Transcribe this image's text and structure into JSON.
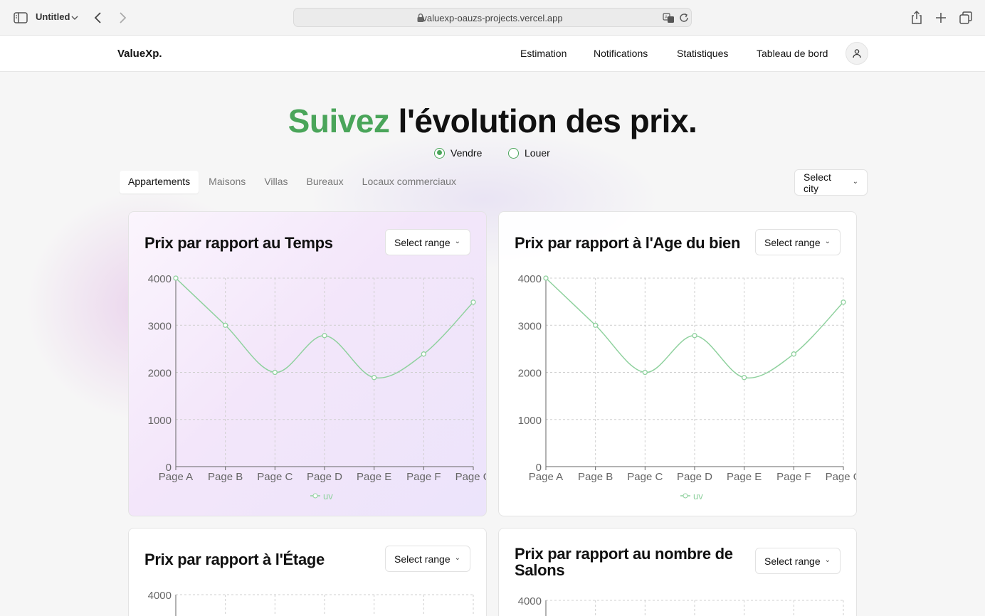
{
  "browser": {
    "tab_title": "Untitled",
    "url": "valuexp-oauzs-projects.vercel.app",
    "icons": [
      "sidebar-icon",
      "chevron-down-icon",
      "back-icon",
      "forward-icon",
      "lock-icon",
      "translate-icon",
      "reload-icon",
      "share-icon",
      "plus-icon",
      "tabs-icon"
    ]
  },
  "nav": {
    "brand": "ValueXp.",
    "links": [
      "Estimation",
      "Notifications",
      "Statistiques",
      "Tableau de bord"
    ],
    "avatar_icon": "user-icon"
  },
  "hero": {
    "accent_word": "Suivez",
    "rest": " l'évolution des prix.",
    "accent_color": "#4aa55a"
  },
  "mode": {
    "options": [
      "Vendre",
      "Louer"
    ],
    "selected": "Vendre"
  },
  "tabs": {
    "items": [
      "Appartements",
      "Maisons",
      "Villas",
      "Bureaux",
      "Locaux commerciaux"
    ],
    "active": "Appartements"
  },
  "city_select": {
    "label": "Select city"
  },
  "cards": [
    {
      "title": "Prix par rapport au Temps",
      "select_label": "Select range"
    },
    {
      "title": "Prix par rapport à l'Age du bien",
      "select_label": "Select range"
    },
    {
      "title": "Prix par rapport à l'Étage",
      "select_label": "Select range"
    },
    {
      "title": "Prix par rapport au nombre de Salons",
      "select_label": "Select range"
    }
  ],
  "chart_data": [
    {
      "type": "line",
      "categories": [
        "Page A",
        "Page B",
        "Page C",
        "Page D",
        "Page E",
        "Page F",
        "Page G"
      ],
      "series": [
        {
          "name": "uv",
          "values": [
            4000,
            3000,
            2000,
            2780,
            1890,
            2390,
            3490
          ]
        }
      ],
      "yticks": [
        0,
        1000,
        2000,
        3000,
        4000
      ],
      "ylim": [
        0,
        4000
      ],
      "grid": true,
      "legend": "bottom",
      "line_color": "#8fd19e"
    },
    {
      "type": "line",
      "categories": [
        "Page A",
        "Page B",
        "Page C",
        "Page D",
        "Page E",
        "Page F",
        "Page G"
      ],
      "series": [
        {
          "name": "uv",
          "values": [
            4000,
            3000,
            2000,
            2780,
            1890,
            2390,
            3490
          ]
        }
      ],
      "yticks": [
        0,
        1000,
        2000,
        3000,
        4000
      ],
      "ylim": [
        0,
        4000
      ],
      "grid": true,
      "legend": "bottom",
      "line_color": "#8fd19e"
    },
    {
      "type": "line",
      "series": [],
      "yticks": [
        4000
      ],
      "grid": true
    },
    {
      "type": "line",
      "series": [],
      "yticks": [
        4000
      ],
      "grid": true
    }
  ]
}
